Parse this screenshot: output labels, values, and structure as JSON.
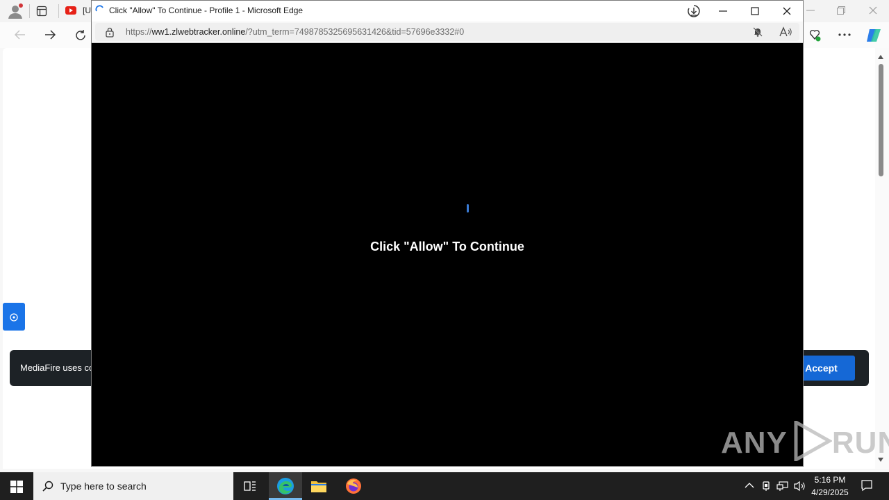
{
  "background_browser": {
    "tab_label": "[U",
    "cookie_text": "MediaFire uses co",
    "accept_label": "Accept"
  },
  "popup": {
    "window_title": "Click \"Allow\" To Continue - Profile 1 - Microsoft Edge",
    "url_prefix": "https://",
    "url_domain": "ww1.zlwebtracker.online",
    "url_rest": "/?utm_term=7498785325695631426&tid=57696e3332#0",
    "content_text": "Click \"Allow\" To Continue"
  },
  "watermark": "ANY RUN",
  "taskbar": {
    "search_placeholder": "Type here to search",
    "time": "5:16 PM",
    "date": "4/29/2025"
  },
  "colors": {
    "accent_blue": "#1568d6",
    "popup_background": "#000000",
    "cookie_bar": "#1d2226",
    "taskbar": "#1f1f1f"
  }
}
